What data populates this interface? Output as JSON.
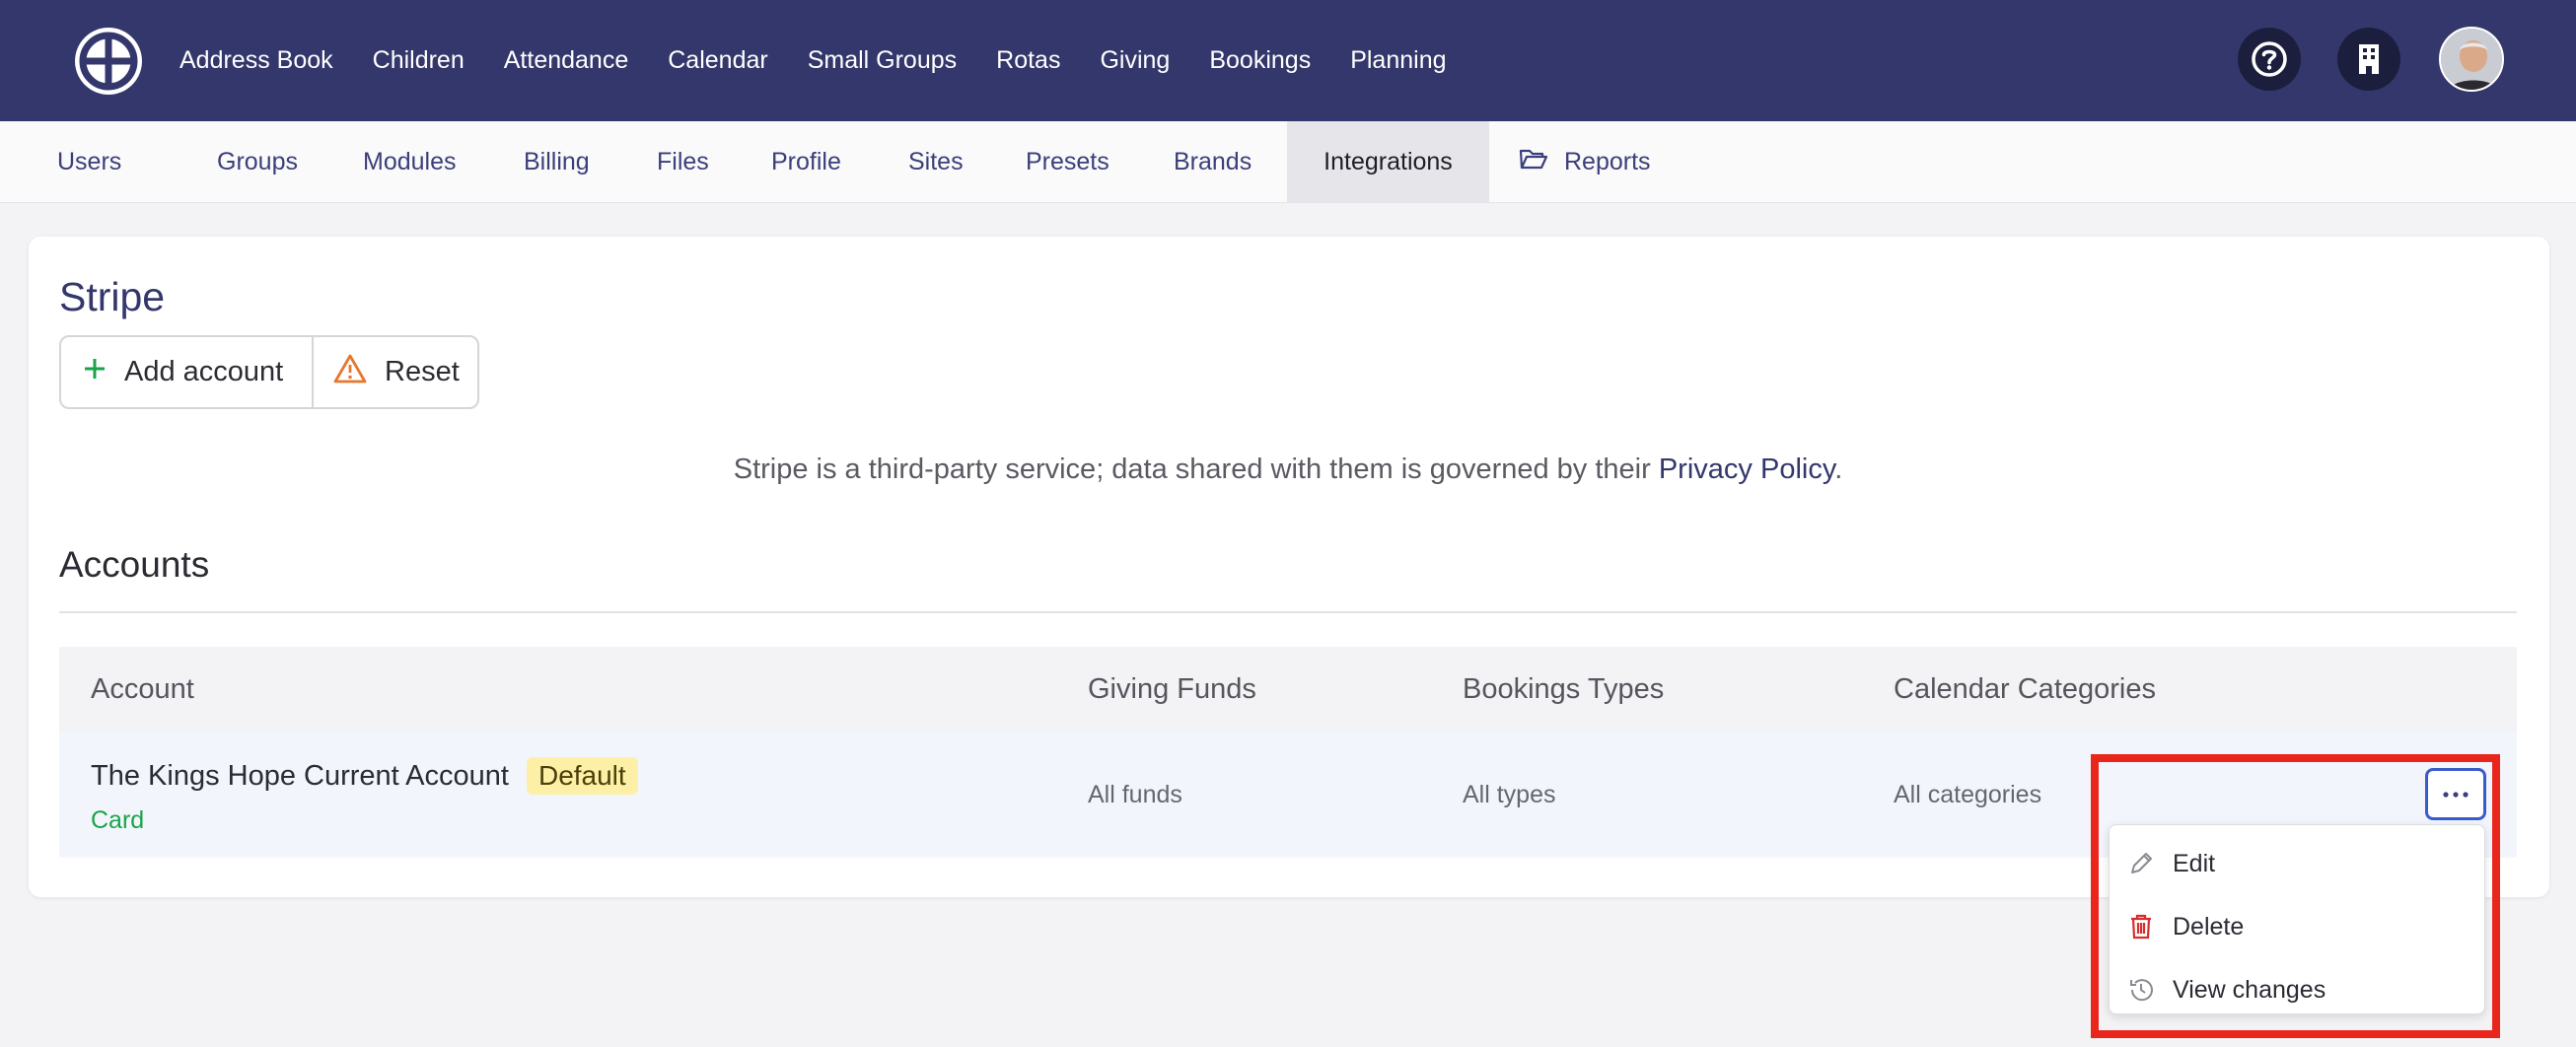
{
  "app": {
    "nav_items": [
      "Address Book",
      "Children",
      "Attendance",
      "Calendar",
      "Small Groups",
      "Rotas",
      "Giving",
      "Bookings",
      "Planning"
    ],
    "icons": [
      "logo-icon",
      "help-icon",
      "building-icon",
      "user-avatar"
    ]
  },
  "subnav": {
    "tabs": [
      "Users",
      "Groups",
      "Modules",
      "Billing",
      "Files",
      "Profile",
      "Sites",
      "Presets",
      "Brands",
      "Integrations",
      "Reports"
    ],
    "active": "Integrations"
  },
  "page": {
    "title": "Stripe",
    "add_account_label": "Add account",
    "reset_label": "Reset",
    "disclaimer_text": "Stripe is a third-party service; data shared with them is governed by their ",
    "privacy_link": "Privacy Policy",
    "disclaimer_end": "."
  },
  "accounts": {
    "heading": "Accounts",
    "columns": [
      "Account",
      "Giving Funds",
      "Bookings Types",
      "Calendar Categories"
    ],
    "rows": [
      {
        "name": "The Kings Hope Current Account",
        "badge": "Default",
        "method": "Card",
        "funds": "All funds",
        "types": "All types",
        "categories": "All categories"
      }
    ]
  },
  "row_menu": {
    "trigger": "···",
    "items": [
      "Edit",
      "Delete",
      "View changes"
    ]
  },
  "colors": {
    "topbar": "#34376b",
    "accent": "#34376b",
    "success": "#1aa34a",
    "danger": "#d62d2d",
    "warning": "#e8762c",
    "highlight": "#e8261c"
  }
}
